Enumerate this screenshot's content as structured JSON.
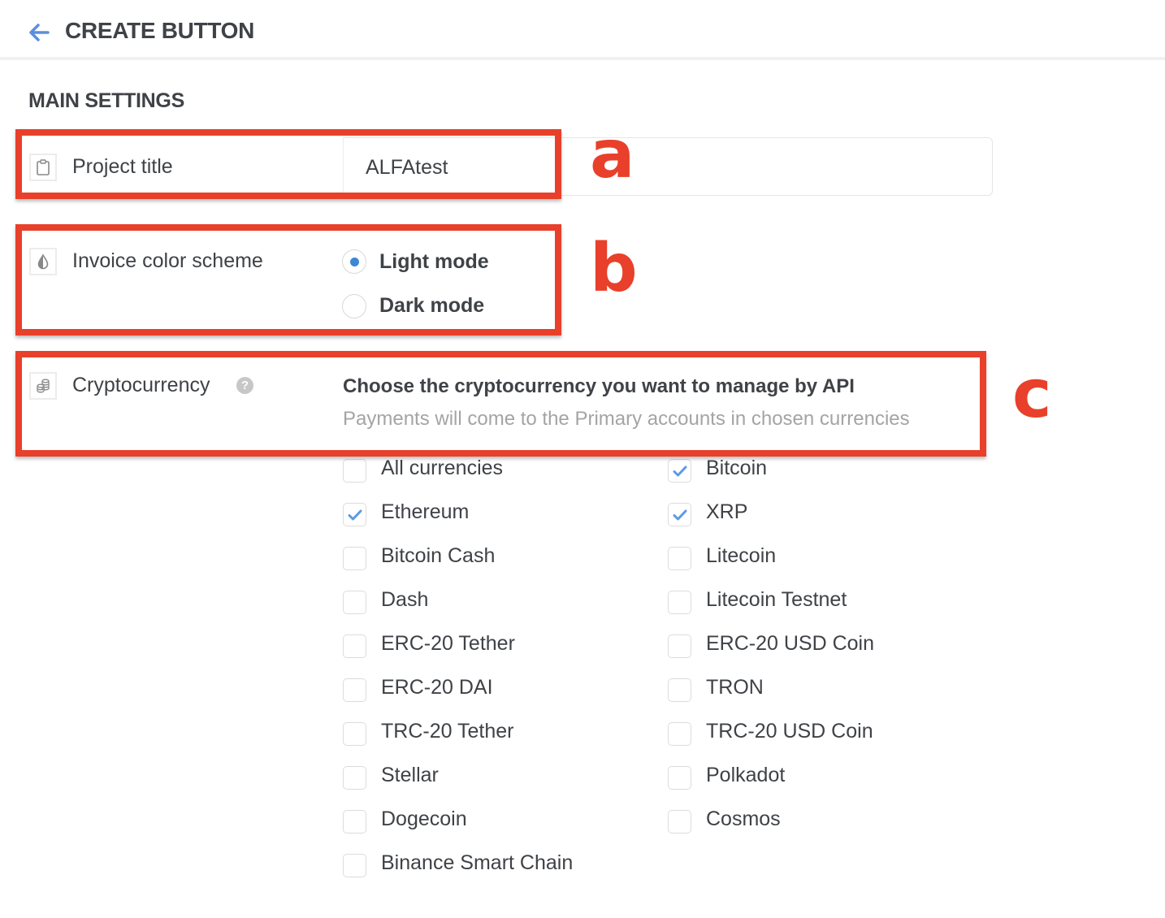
{
  "header": {
    "back_icon": "arrow-left-icon",
    "title": "CREATE BUTTON"
  },
  "section": {
    "title": "MAIN SETTINGS"
  },
  "project_title": {
    "icon": "clipboard-icon",
    "label": "Project title",
    "value": "ALFAtest"
  },
  "color_scheme": {
    "icon": "contrast-drop-icon",
    "label": "Invoice color scheme",
    "options": [
      {
        "label": "Light mode",
        "selected": true
      },
      {
        "label": "Dark mode",
        "selected": false
      }
    ]
  },
  "cryptocurrency": {
    "icon": "coins-stack-icon",
    "label": "Cryptocurrency",
    "help_icon": "question-circle-icon",
    "help_glyph": "?",
    "heading": "Choose the cryptocurrency you want to manage by API",
    "subheading": "Payments will come to the Primary accounts in chosen currencies",
    "options": [
      {
        "label": "All currencies",
        "checked": false
      },
      {
        "label": "Bitcoin",
        "checked": true
      },
      {
        "label": "Ethereum",
        "checked": true
      },
      {
        "label": "XRP",
        "checked": true
      },
      {
        "label": "Bitcoin Cash",
        "checked": false
      },
      {
        "label": "Litecoin",
        "checked": false
      },
      {
        "label": "Dash",
        "checked": false
      },
      {
        "label": "Litecoin Testnet",
        "checked": false
      },
      {
        "label": "ERC-20 Tether",
        "checked": false
      },
      {
        "label": "ERC-20 USD Coin",
        "checked": false
      },
      {
        "label": "ERC-20 DAI",
        "checked": false
      },
      {
        "label": "TRON",
        "checked": false
      },
      {
        "label": "TRC-20 Tether",
        "checked": false
      },
      {
        "label": "TRC-20 USD Coin",
        "checked": false
      },
      {
        "label": "Stellar",
        "checked": false
      },
      {
        "label": "Polkadot",
        "checked": false
      },
      {
        "label": "Dogecoin",
        "checked": false
      },
      {
        "label": "Cosmos",
        "checked": false
      },
      {
        "label": "Binance Smart Chain",
        "checked": false
      }
    ]
  },
  "annotations": {
    "a": "a",
    "b": "b",
    "c": "c"
  },
  "colors": {
    "accent": "#3c87d4",
    "check": "#5b9be6",
    "annotation": "#e8402a",
    "text": "#3f4246",
    "muted": "#a4a4a4"
  }
}
